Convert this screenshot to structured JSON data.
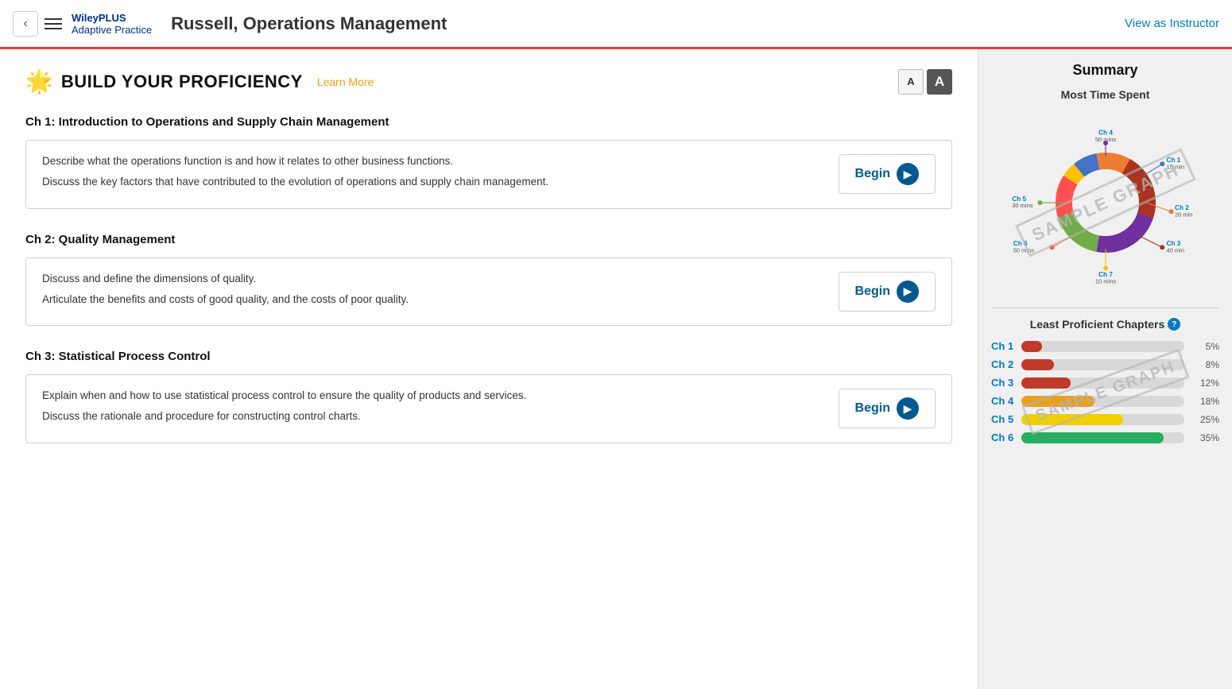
{
  "header": {
    "back_label": "‹",
    "brand_top": "WileyPLUS",
    "brand_bottom": "Adaptive Practice",
    "title": "Russell, Operations Management",
    "view_as_instructor": "View as Instructor"
  },
  "main": {
    "byp_title": "BUILD YOUR PROFICIENCY",
    "byp_learn_more": "Learn More",
    "font_small_label": "A",
    "font_large_label": "A",
    "chapters": [
      {
        "heading": "Ch 1: Introduction to Operations and Supply Chain Management",
        "bullets": [
          "Describe what the operations function is and how it relates to other business functions.",
          "Discuss the key factors that have contributed to the evolution of operations and supply chain management."
        ],
        "begin_label": "Begin"
      },
      {
        "heading": "Ch 2: Quality Management",
        "bullets": [
          "Discuss and define the dimensions of quality.",
          "Articulate the benefits and costs of good quality, and the costs of poor quality."
        ],
        "begin_label": "Begin"
      },
      {
        "heading": "Ch 3: Statistical Process Control",
        "bullets": [
          "Explain when and how to use statistical process control to ensure the quality of products and services.",
          "Discuss the rationale and procedure for constructing control charts."
        ],
        "begin_label": "Begin"
      }
    ]
  },
  "sidebar": {
    "title": "Summary",
    "most_time_spent_label": "Most Time Spent",
    "sample_graph_label": "SAMPLE GRAPH",
    "donut_data": [
      {
        "ch": "Ch 1",
        "time": "15 min",
        "color": "#4472c4",
        "pct": 8
      },
      {
        "ch": "Ch 2",
        "time": "20 min",
        "color": "#ed7d31",
        "pct": 11
      },
      {
        "ch": "Ch 3",
        "time": "40 min",
        "color": "#a9341f",
        "pct": 22
      },
      {
        "ch": "Ch 4",
        "time": "50 mins",
        "color": "#7030a0",
        "pct": 28
      },
      {
        "ch": "Ch 5",
        "time": "30 mins",
        "color": "#70ad47",
        "pct": 17
      },
      {
        "ch": "Ch 6",
        "time": "50 mins",
        "color": "#ff0000",
        "pct": 14
      },
      {
        "ch": "Ch 7",
        "time": "10 mins",
        "color": "#ffc000",
        "pct": 5
      }
    ],
    "least_proficient_label": "Least Proficient Chapters",
    "bars": [
      {
        "ch": "Ch 1",
        "pct": 5,
        "color": "#c0392b"
      },
      {
        "ch": "Ch 2",
        "pct": 8,
        "color": "#c0392b"
      },
      {
        "ch": "Ch 3",
        "pct": 12,
        "color": "#c0392b"
      },
      {
        "ch": "Ch 4",
        "pct": 18,
        "color": "#e8a020"
      },
      {
        "ch": "Ch 5",
        "pct": 25,
        "color": "#f0d000"
      },
      {
        "ch": "Ch 6",
        "pct": 35,
        "color": "#27ae60"
      }
    ]
  }
}
